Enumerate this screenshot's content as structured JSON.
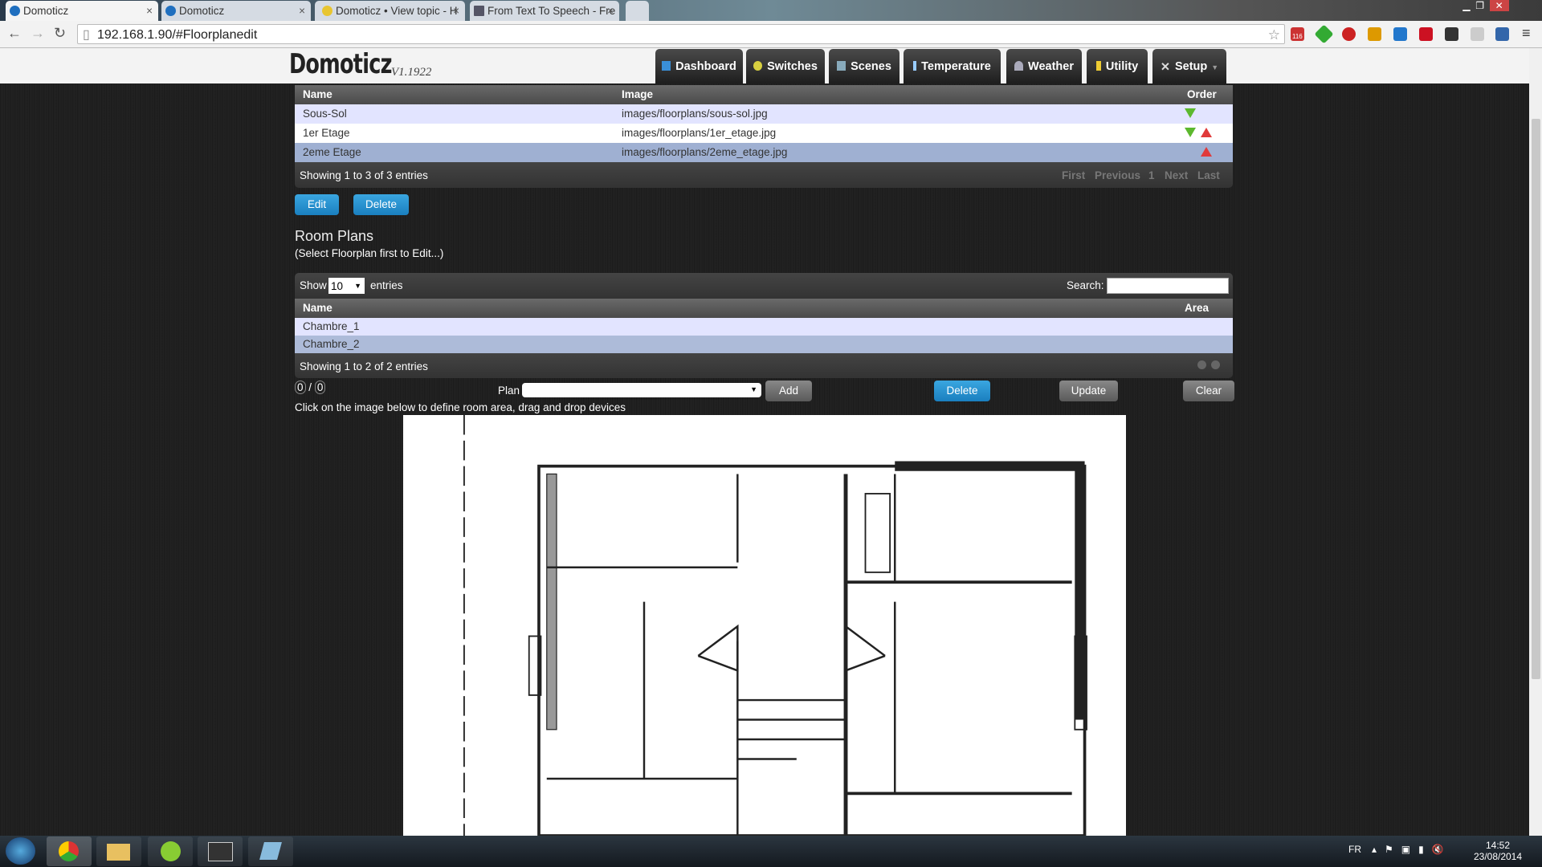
{
  "browser": {
    "tabs": [
      {
        "label": "Domoticz",
        "active": true
      },
      {
        "label": "Domoticz"
      },
      {
        "label": "Domoticz • View topic - H"
      },
      {
        "label": "From Text To Speech - Fre"
      }
    ],
    "url": "192.168.1.90/#Floorplanedit",
    "extension_badge": "116"
  },
  "app": {
    "logo": "Domoticz",
    "version": "V1.1922",
    "nav": [
      {
        "label": "Dashboard",
        "icon": "dashboard-icon"
      },
      {
        "label": "Switches",
        "icon": "bulb-icon"
      },
      {
        "label": "Scenes",
        "icon": "scenes-icon"
      },
      {
        "label": "Temperature",
        "icon": "thermometer-icon"
      },
      {
        "label": "Weather",
        "icon": "cloud-rain-icon"
      },
      {
        "label": "Utility",
        "icon": "lightning-icon"
      },
      {
        "label": "Setup",
        "icon": "tools-icon"
      }
    ]
  },
  "floorplans": {
    "headers": {
      "name": "Name",
      "image": "Image",
      "order": "Order"
    },
    "rows": [
      {
        "name": "Sous-Sol",
        "image": "images/floorplans/sous-sol.jpg",
        "order": [
          "down"
        ]
      },
      {
        "name": "1er Etage",
        "image": "images/floorplans/1er_etage.jpg",
        "order": [
          "down",
          "up"
        ]
      },
      {
        "name": "2eme Etage",
        "image": "images/floorplans/2eme_etage.jpg",
        "order": [
          "up"
        ],
        "selected": true
      }
    ],
    "info": "Showing 1 to 3 of 3 entries",
    "pagination": {
      "first": "First",
      "previous": "Previous",
      "page": "1",
      "next": "Next",
      "last": "Last"
    },
    "edit_label": "Edit",
    "delete_label": "Delete"
  },
  "roomplans": {
    "title": "Room Plans",
    "subtitle": "(Select Floorplan first to Edit...)",
    "show_label": "Show",
    "entries_value": "10",
    "entries_label": "entries",
    "search_label": "Search:",
    "search_value": "",
    "headers": {
      "name": "Name",
      "area": "Area"
    },
    "rows": [
      {
        "name": "Chambre_1",
        "area": ""
      },
      {
        "name": "Chambre_2",
        "area": "",
        "selected": true
      }
    ],
    "info": "Showing 1 to 2 of 2 entries"
  },
  "editor": {
    "counter_a": "0",
    "counter_sep": "/",
    "counter_b": "0",
    "plan_label": "Plan",
    "plan_value": "",
    "add_label": "Add",
    "delete_label": "Delete",
    "update_label": "Update",
    "clear_label": "Clear",
    "hint": "Click on the image below to define room area, drag and drop devices"
  },
  "taskbar": {
    "lang": "FR",
    "time": "14:52",
    "date": "23/08/2014"
  },
  "colors": {
    "row_odd": "#e2e4ff",
    "row_even": "#ffffff",
    "row_selected": "#9fb0d2",
    "accent_blue": "#2a93d5"
  }
}
